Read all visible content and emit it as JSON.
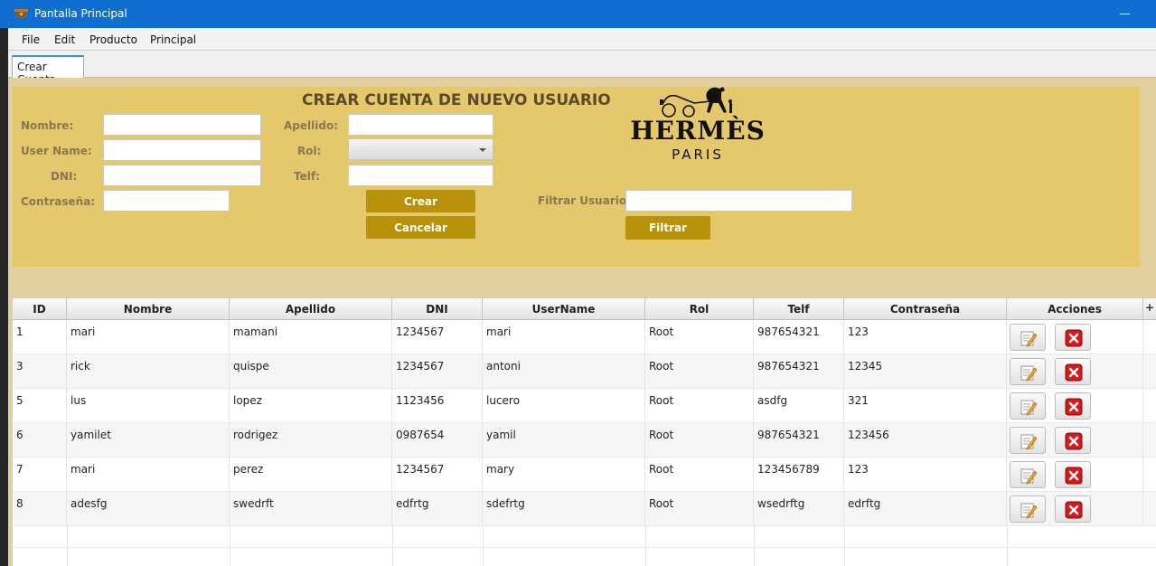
{
  "window": {
    "title": "Pantalla Principal",
    "icon": "app-icon"
  },
  "menu": [
    "File",
    "Edit",
    "Producto",
    "Principal"
  ],
  "tabs": [
    {
      "label": "Crear Cuenta",
      "active": true
    }
  ],
  "form": {
    "title": "CREAR CUENTA DE NUEVO USUARIO",
    "labels": {
      "nombre": "Nombre:",
      "apellido": "Apellido:",
      "username": "User Name:",
      "rol": "Rol:",
      "dni": "DNI:",
      "telf": "Telf:",
      "contrasena": "Contraseña:",
      "filtrar": "Filtrar Usuario :"
    },
    "values": {
      "nombre": "",
      "apellido": "",
      "username": "",
      "rol": "",
      "dni": "",
      "telf": "",
      "contrasena": "",
      "filtrar": ""
    },
    "buttons": {
      "crear": "Crear",
      "cancelar": "Cancelar",
      "filtrar": "Filtrar"
    },
    "logo": {
      "brand": "HERMÈS",
      "city": "PARIS"
    },
    "accent_color": "#b8920a",
    "panel_color": "#e5c86c"
  },
  "table": {
    "columns": [
      "ID",
      "Nombre",
      "Apellido",
      "DNI",
      "UserName",
      "Rol",
      "Telf",
      "Contraseña",
      "Acciones"
    ],
    "rows": [
      [
        "1",
        "mari",
        "mamani",
        "1234567",
        "mari",
        "Root",
        "987654321",
        "123"
      ],
      [
        "3",
        "rick",
        "quispe",
        "1234567",
        "antoni",
        "Root",
        "987654321",
        "12345"
      ],
      [
        "5",
        "lus",
        "lopez",
        "1123456",
        "lucero",
        "Root",
        "asdfg",
        "321"
      ],
      [
        "6",
        "yamilet",
        "rodrigez",
        "0987654",
        "yamil",
        "Root",
        "987654321",
        "123456"
      ],
      [
        "7",
        "mari",
        "perez",
        "1234567",
        "mary",
        "Root",
        "123456789",
        "123"
      ],
      [
        "8",
        "adesfg",
        "swedrft",
        "edfrtg",
        "sdefrtg",
        "Root",
        "wsedrftg",
        "edrftg"
      ]
    ],
    "row_actions": [
      "edit-icon",
      "delete-icon"
    ],
    "header_extra": "+"
  }
}
